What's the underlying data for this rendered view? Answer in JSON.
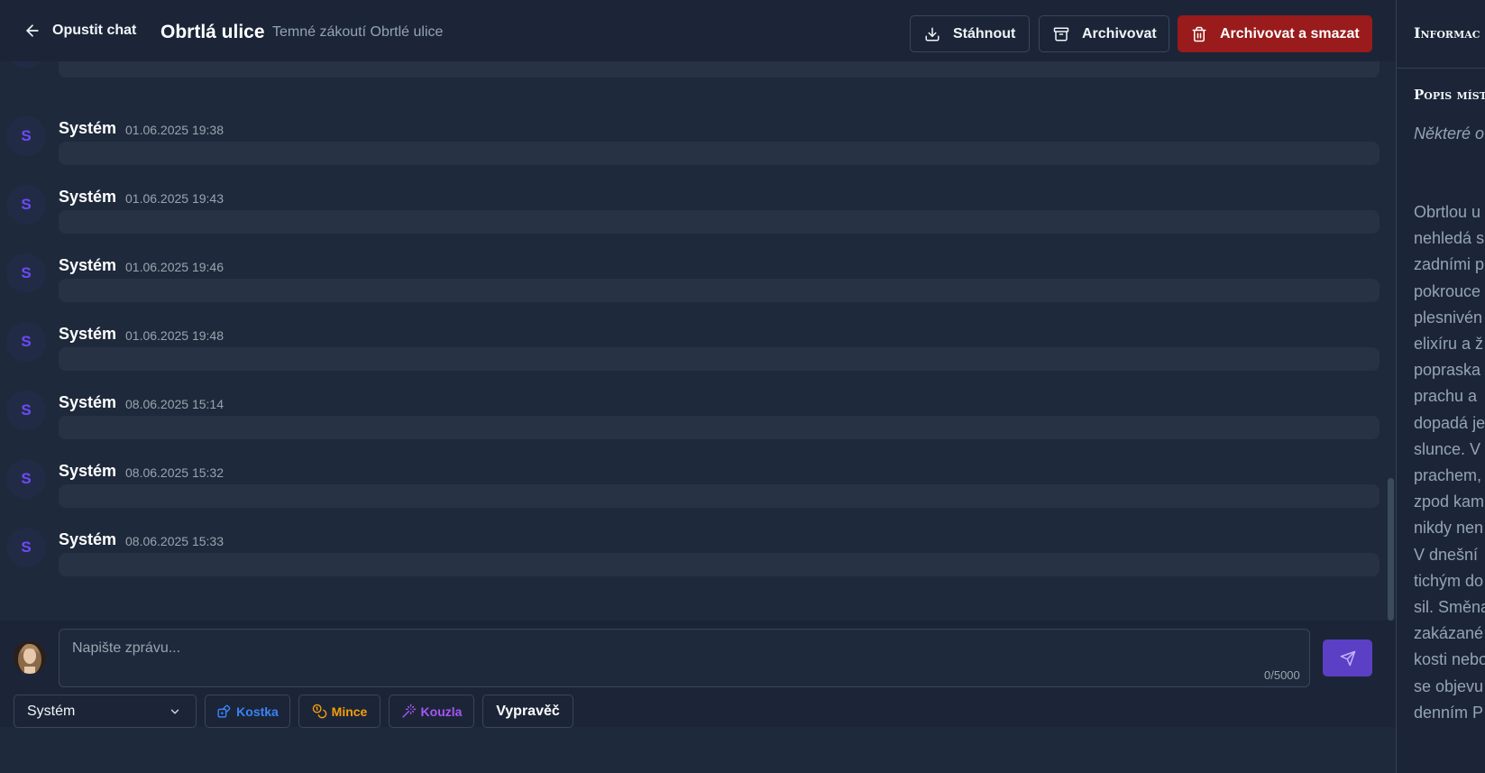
{
  "header": {
    "back_label": "Opustit chat",
    "title": "Obrtlá ulice",
    "subtitle": "Temné zákoutí Obrtlé ulice",
    "download_label": "Stáhnout",
    "archive_label": "Archivovat",
    "archive_delete_label": "Archivovat a smazat"
  },
  "messages": [
    {
      "avatar": "S",
      "author": "Systém",
      "time": "01.06.2025 19:38"
    },
    {
      "avatar": "S",
      "author": "Systém",
      "time": "01.06.2025 19:43"
    },
    {
      "avatar": "S",
      "author": "Systém",
      "time": "01.06.2025 19:46"
    },
    {
      "avatar": "S",
      "author": "Systém",
      "time": "01.06.2025 19:48"
    },
    {
      "avatar": "S",
      "author": "Systém",
      "time": "08.06.2025 15:14"
    },
    {
      "avatar": "S",
      "author": "Systém",
      "time": "08.06.2025 15:32"
    },
    {
      "avatar": "S",
      "author": "Systém",
      "time": "08.06.2025 15:33"
    }
  ],
  "composer": {
    "placeholder": "Napište zprávu...",
    "char_count": "0/5000",
    "selected_sender": "Systém",
    "kostka_label": "Kostka",
    "mince_label": "Mince",
    "kouzla_label": "Kouzla",
    "vypravec_label": "Vypravěč"
  },
  "sidebar": {
    "title": "Informac",
    "heading": "Popis míst",
    "italic_text": "Některé o pohltí.",
    "text_lines": [
      "Obrtlou u",
      "nehledá s",
      "zadními p",
      "pokrouce",
      "plesnivén",
      "elixíru a ž",
      "popraska",
      "prachu a",
      "dopadá je",
      "slunce. V",
      "prachem,",
      "zpod kam",
      "nikdy nen",
      "V dnešní",
      "tichým do",
      "sil. Směna",
      "zakázané",
      "kosti nebo",
      "se objevu",
      "denním P"
    ]
  },
  "colors": {
    "accent": "#6d4aff",
    "danger": "#991b1b",
    "send": "#5b3fc4"
  }
}
